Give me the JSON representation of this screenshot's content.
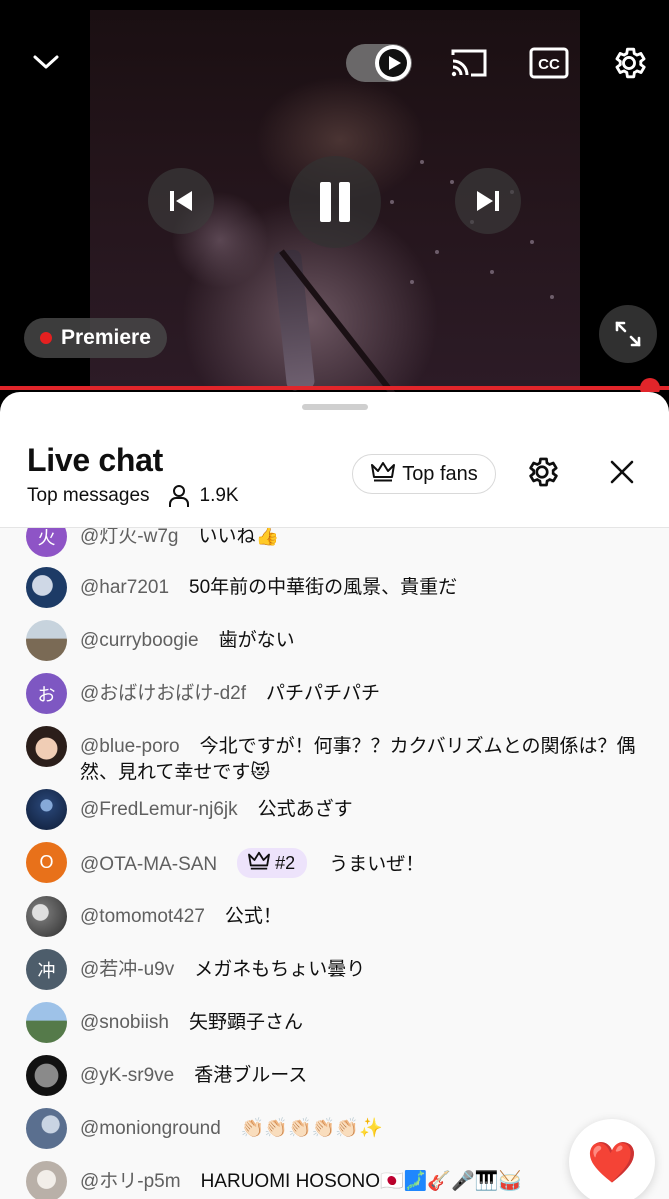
{
  "player": {
    "premiere_label": "Premiere",
    "cc_label": "CC"
  },
  "chat": {
    "title": "Live chat",
    "mode": "Top messages",
    "viewer_count": "1.9K",
    "top_fans_label": "Top fans",
    "messages": [
      {
        "avatar_text": "火",
        "avatar_color": "#8e54c6",
        "author": "@灯火-w7g",
        "text": "いいね👍"
      },
      {
        "avatar_text": "",
        "avatar_color": "#1d3b66",
        "author": "@har7201",
        "text": "50年前の中華街の風景、貴重だ"
      },
      {
        "avatar_text": "",
        "avatar_color": "#7a6a55",
        "author": "@curryboogie",
        "text": "歯がない"
      },
      {
        "avatar_text": "お",
        "avatar_color": "#7e57c2",
        "author": "@おばけおばけ-d2f",
        "text": "パチパチパチ"
      },
      {
        "avatar_text": "",
        "avatar_color": "#c9a08a",
        "author": "@blue-poro",
        "text": "今北ですが！何事？？カクバリズムとの関係は？偶然、見れて幸せです😻"
      },
      {
        "avatar_text": "",
        "avatar_color": "#25406e",
        "author": "@FredLemur-nj6jk",
        "text": "公式あざす"
      },
      {
        "avatar_text": "O",
        "avatar_color": "#e8711a",
        "author": "@OTA-MA-SAN",
        "badge": "#2",
        "text": "うまいぜ！"
      },
      {
        "avatar_text": "",
        "avatar_color": "#6e6e6e",
        "author": "@tomomot427",
        "text": "公式！"
      },
      {
        "avatar_text": "冲",
        "avatar_color": "#4d5d6b",
        "author": "@若冲-u9v",
        "text": "メガネもちょい曇り"
      },
      {
        "avatar_text": "",
        "avatar_color": "#557a4a",
        "author": "@snobiish",
        "text": "矢野顕子さん"
      },
      {
        "avatar_text": "",
        "avatar_color": "#2a2a2a",
        "author": "@yK-sr9ve",
        "text": "香港ブルース"
      },
      {
        "avatar_text": "",
        "avatar_color": "#5a6f8f",
        "author": "@monionground",
        "text": "👏🏻👏🏻👏🏻👏🏻👏🏻✨"
      },
      {
        "avatar_text": "",
        "avatar_color": "#b9b0a8",
        "author": "@ホリ-p5m",
        "text": "HARUOMI HOSONO🇯🇵🗾🎸🎤🎹🥁"
      }
    ]
  },
  "heart": "❤️"
}
